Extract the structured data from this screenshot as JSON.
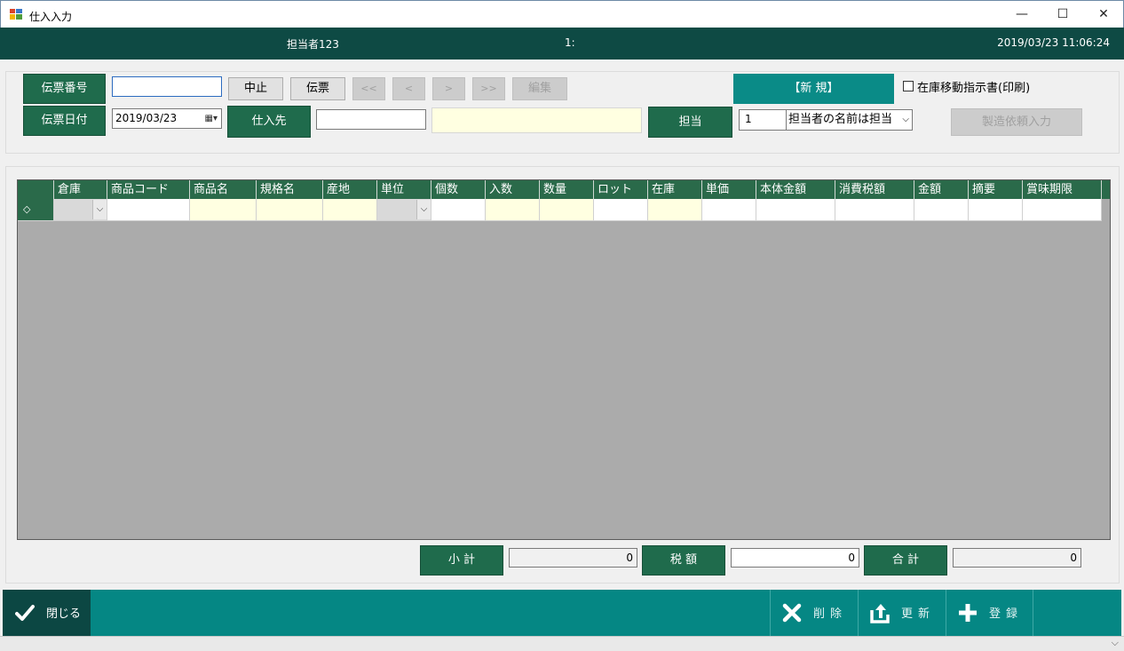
{
  "window": {
    "title": "仕入入力",
    "minimize": "—",
    "maximize": "☐",
    "close": "✕"
  },
  "header": {
    "user": "担当者123",
    "page": "1:",
    "datetime": "2019/03/23 11:06:24"
  },
  "form": {
    "slip_number_label": "伝票番号",
    "slip_number_value": "",
    "cancel_button": "中止",
    "slip_button": "伝票",
    "nav_first": "<<",
    "nav_prev": "<",
    "nav_next": ">",
    "nav_last": ">>",
    "edit_button": "編集",
    "mode_badge": "【新 規】",
    "transfer_checkbox_label": "在庫移動指示書(印刷)",
    "transfer_checked": false,
    "slip_date_label": "伝票日付",
    "slip_date_value": "2019/03/23",
    "supplier_label": "仕入先",
    "supplier_code": "",
    "supplier_name": "",
    "staff_label": "担当",
    "staff_code": "1",
    "staff_name": "担当者の名前は担当",
    "manufacture_button": "製造依頼入力"
  },
  "grid": {
    "columns": [
      "",
      "倉庫",
      "商品コード",
      "商品名",
      "規格名",
      "産地",
      "単位",
      "個数",
      "入数",
      "数量",
      "ロット",
      "在庫",
      "単価",
      "本体金額",
      "消費税額",
      "金額",
      "摘要",
      "賞味期限"
    ],
    "row_marker": "◇"
  },
  "totals": {
    "subtotal_label": "小 計",
    "subtotal_value": "0",
    "tax_label": "税 額",
    "tax_value": "0",
    "total_label": "合 計",
    "total_value": "0"
  },
  "actions": {
    "close": "閉じる",
    "delete": "削除",
    "update": "更新",
    "register": "登録"
  },
  "colors": {
    "header_bar": "#0e4a44",
    "label_green": "#1f6b4c",
    "action_bar": "#058784",
    "input_yellow": "#ffffe1"
  }
}
